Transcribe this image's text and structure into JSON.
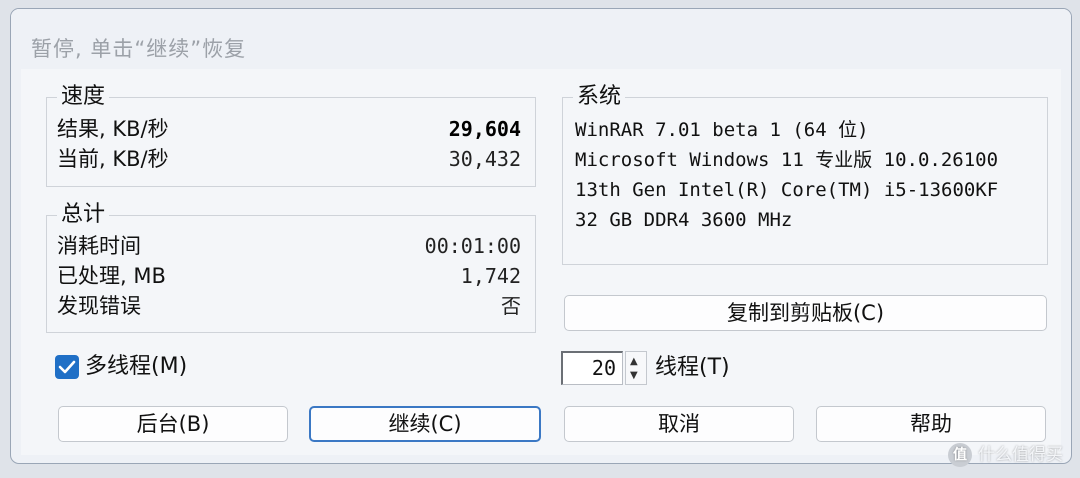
{
  "window": {
    "title": "暂停, 单击“继续”恢复"
  },
  "speed": {
    "title": "速度",
    "rows": [
      {
        "label": "结果, KB/秒",
        "value": "29,604"
      },
      {
        "label": "当前, KB/秒",
        "value": "30,432"
      }
    ]
  },
  "total": {
    "title": "总计",
    "rows": [
      {
        "label": "消耗时间",
        "value": "00:01:00"
      },
      {
        "label": "已处理, MB",
        "value": "1,742"
      },
      {
        "label": "发现错误",
        "value": "否"
      }
    ]
  },
  "system": {
    "title": "系统",
    "lines": [
      "WinRAR 7.01 beta 1 (64 位)",
      "Microsoft Windows 11 专业版 10.0.26100",
      "13th Gen Intel(R) Core(TM) i5-13600KF",
      "32 GB DDR4 3600 MHz"
    ]
  },
  "copy_button": "复制到剪贴板(C)",
  "multithread": {
    "label": "多线程(M)",
    "checked": true
  },
  "threads": {
    "value": "20",
    "label": "线程(T)"
  },
  "buttons": {
    "background": "后台(B)",
    "continue": "继续(C)",
    "cancel": "取消",
    "help": "帮助"
  },
  "watermark": {
    "logo": "值",
    "text": "什么值得买"
  },
  "colors": {
    "accent": "#1f6fc6",
    "default_button_border": "#3b78c4"
  }
}
